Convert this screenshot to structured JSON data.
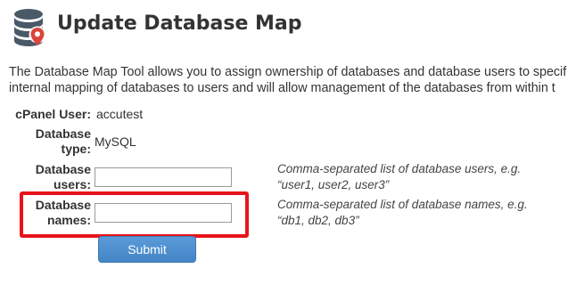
{
  "header": {
    "title": "Update Database Map",
    "icon": "database-map-icon"
  },
  "intro": {
    "line1": "The Database Map Tool allows you to assign ownership of databases and database users to specif",
    "line2": "internal mapping of databases to users and will allow management of the databases from within t"
  },
  "form": {
    "cpanel_user": {
      "label": "cPanel User:",
      "value": "accutest"
    },
    "db_type": {
      "label_line1": "Database",
      "label_line2": "type:",
      "value": "MySQL"
    },
    "db_users": {
      "label_line1": "Database",
      "label_line2": "users:",
      "value": "",
      "help_line1": "Comma-separated list of database users, e.g.",
      "help_line2": "“user1, user2, user3”"
    },
    "db_names": {
      "label_line1": "Database",
      "label_line2": "names:",
      "value": "",
      "help_line1": "Comma-separated list of database names, e.g.",
      "help_line2": "“db1, db2, db3”"
    },
    "submit_label": "Submit"
  },
  "colors": {
    "highlight_border": "#e8131a",
    "button": "#4a8bcc",
    "icon_dark": "#4a5968",
    "icon_pin": "#d9453c"
  }
}
